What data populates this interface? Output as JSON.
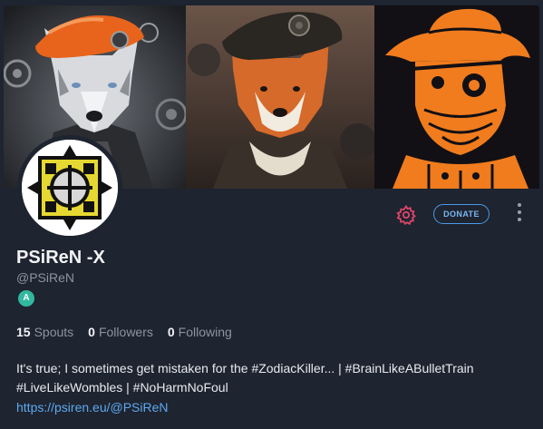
{
  "profile": {
    "display_name": "PSiReN -X",
    "handle": "@PSiReN",
    "badge_letter": "A",
    "bio": "It's true; I sometimes get mistaken for the #ZodiacKiller... | #BrainLikeABulletTrain #LiveLikeWombles | #NoHarmNoFoul",
    "link": "https://psiren.eu/@PSiReN"
  },
  "stats": {
    "spouts_count": "15",
    "spouts_label": "Spouts",
    "followers_count": "0",
    "followers_label": "Followers",
    "following_count": "0",
    "following_label": "Following"
  },
  "actions": {
    "donate_label": "DONATE",
    "settings_icon": "gear-icon",
    "more_icon": "more-vertical-icon"
  },
  "colors": {
    "background": "#1e2430",
    "accent_link": "#5fa8ee",
    "gear": "#e0456a",
    "badge": "#33b8a0",
    "banner_orange": "#f07c1e"
  }
}
